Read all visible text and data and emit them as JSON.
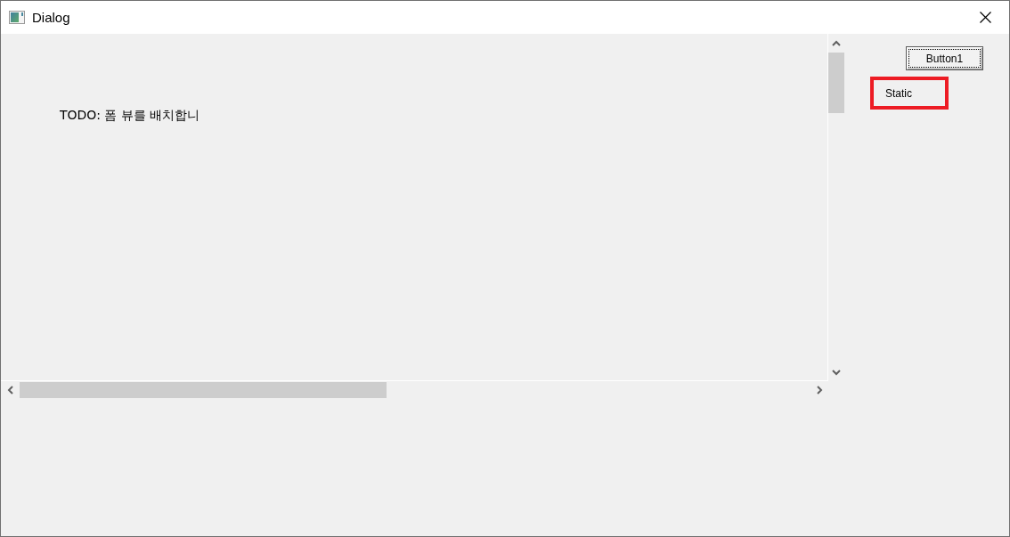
{
  "window": {
    "title": "Dialog"
  },
  "form_view": {
    "text": "TODO: 폼 뷰를 배치합니"
  },
  "buttons": [
    {
      "label": "Button1",
      "focused": true
    }
  ],
  "static": {
    "label": "Static"
  }
}
